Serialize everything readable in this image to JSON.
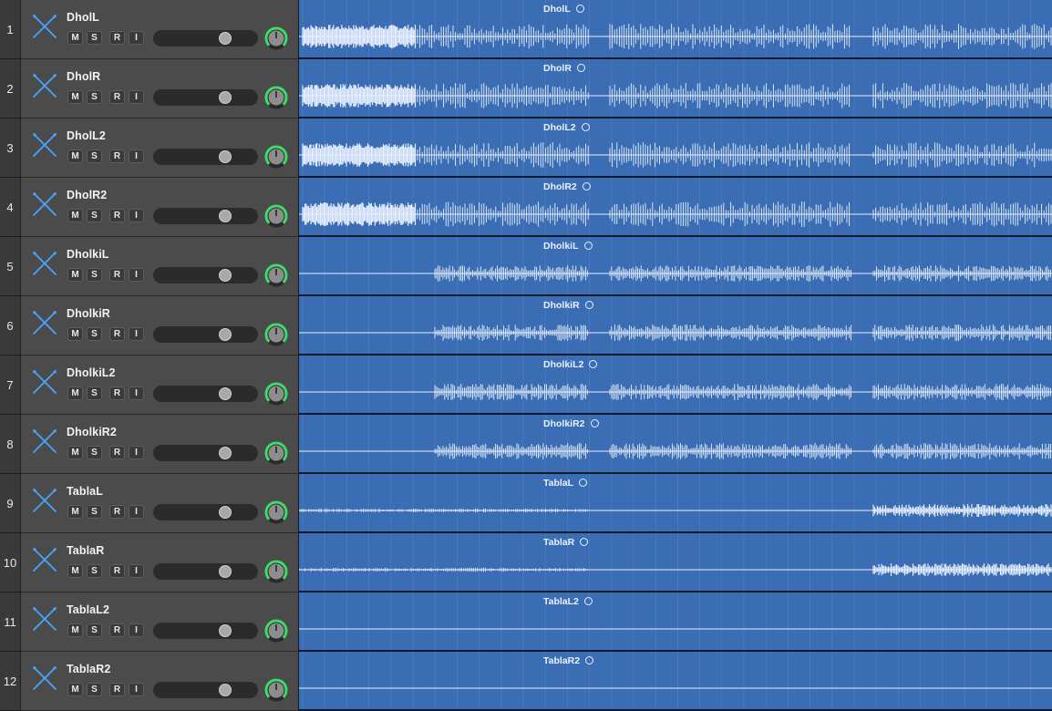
{
  "colors": {
    "header_bg": "#4b4b4b",
    "region_bg": "#3a6db3",
    "waveform": "#e8f0ff",
    "pan_green": "#3ddc6a"
  },
  "button_labels": {
    "mute": "M",
    "solo": "S",
    "record": "R",
    "input": "I"
  },
  "tracks": [
    {
      "number": "1",
      "name": "DholL",
      "region": "DholL",
      "pattern": "dhol",
      "volume": 0.72,
      "pan": 0.5
    },
    {
      "number": "2",
      "name": "DholR",
      "region": "DholR",
      "pattern": "dhol",
      "volume": 0.72,
      "pan": 0.5
    },
    {
      "number": "3",
      "name": "DholL2",
      "region": "DholL2",
      "pattern": "dhol",
      "volume": 0.72,
      "pan": 0.5
    },
    {
      "number": "4",
      "name": "DholR2",
      "region": "DholR2",
      "pattern": "dhol",
      "volume": 0.72,
      "pan": 0.5
    },
    {
      "number": "5",
      "name": "DholkiL",
      "region": "DholkiL",
      "pattern": "dholki",
      "volume": 0.72,
      "pan": 0.5
    },
    {
      "number": "6",
      "name": "DholkiR",
      "region": "DholkiR",
      "pattern": "dholki",
      "volume": 0.72,
      "pan": 0.5
    },
    {
      "number": "7",
      "name": "DholkiL2",
      "region": "DholkiL2",
      "pattern": "dholki",
      "volume": 0.72,
      "pan": 0.5
    },
    {
      "number": "8",
      "name": "DholkiR2",
      "region": "DholkiR2",
      "pattern": "dholki",
      "volume": 0.72,
      "pan": 0.5
    },
    {
      "number": "9",
      "name": "TablaL",
      "region": "TablaL",
      "pattern": "tabla",
      "volume": 0.72,
      "pan": 0.5
    },
    {
      "number": "10",
      "name": "TablaR",
      "region": "TablaR",
      "pattern": "tabla",
      "volume": 0.72,
      "pan": 0.5
    },
    {
      "number": "11",
      "name": "TablaL2",
      "region": "TablaL2",
      "pattern": "silent",
      "volume": 0.72,
      "pan": 0.5
    },
    {
      "number": "12",
      "name": "TablaR2",
      "region": "TablaR2",
      "pattern": "silent",
      "volume": 0.72,
      "pan": 0.5
    }
  ]
}
